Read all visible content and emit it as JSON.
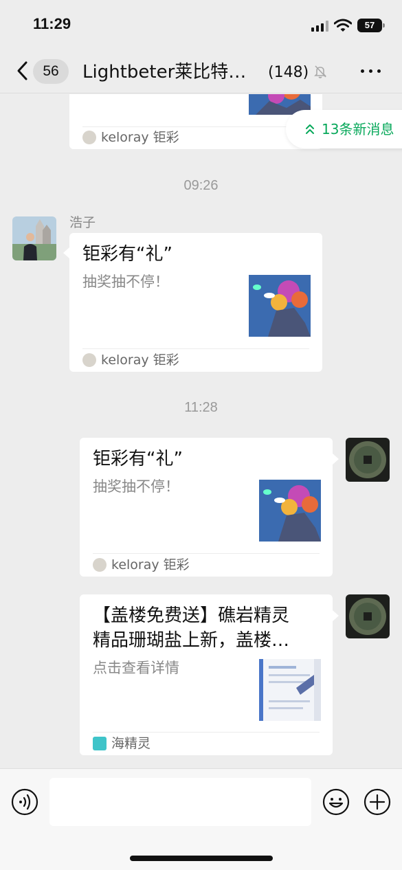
{
  "status": {
    "time": "11:29",
    "battery": "57"
  },
  "nav": {
    "unread_count": "56",
    "title": "Lightbeter莱比特…",
    "member_count": "(148)"
  },
  "new_messages": "13条新消息",
  "messages": [
    {
      "source": "keloray 钜彩"
    },
    {
      "time": "09:26"
    },
    {
      "sender": "浩子",
      "title": "钜彩有“礼”",
      "desc": "抽奖抽不停！",
      "source": "keloray 钜彩"
    },
    {
      "time": "11:28"
    },
    {
      "title": "钜彩有“礼”",
      "desc": "抽奖抽不停！",
      "source": "keloray 钜彩"
    },
    {
      "title_line1": "【盖楼免费送】礁岩精灵",
      "title_line2": "精品珊瑚盐上新，盖楼…",
      "desc": "点击查看详情",
      "source": "海精灵"
    }
  ],
  "colors": {
    "accent_green": "#07a85a",
    "background": "#ededed",
    "bubble": "#ffffff"
  },
  "icons": [
    "back-icon",
    "bell-slash-icon",
    "more-icon",
    "voice-icon",
    "emoji-icon",
    "plus-icon",
    "double-chevron-up-icon"
  ]
}
